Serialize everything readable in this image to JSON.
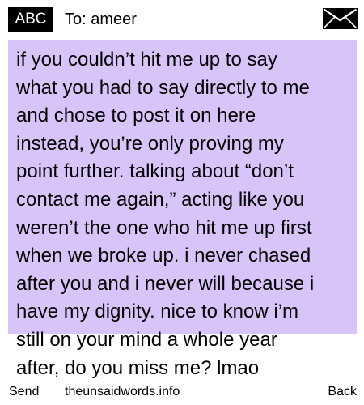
{
  "header": {
    "mode_label": "ABC",
    "recipient": "To: ameer",
    "icon": "envelope-icon"
  },
  "message": {
    "lines": [
      "if you couldn’t hit me up to say",
      "what you had to say directly to me",
      "and chose to post it on here",
      "instead, you’re only proving my",
      "point further. talking about “don’t",
      "contact me again,” acting like you",
      "weren’t the one who hit me up first",
      "when we broke up. i never chased",
      "after you and i never will because i",
      "have my dignity. nice to know i’m",
      "still on your mind a whole year",
      "after, do you miss me? lmao"
    ],
    "highlight_color": "#d9c4fa"
  },
  "footer": {
    "send_label": "Send",
    "site_label": "theunsaidwords.info",
    "back_label": "Back"
  }
}
